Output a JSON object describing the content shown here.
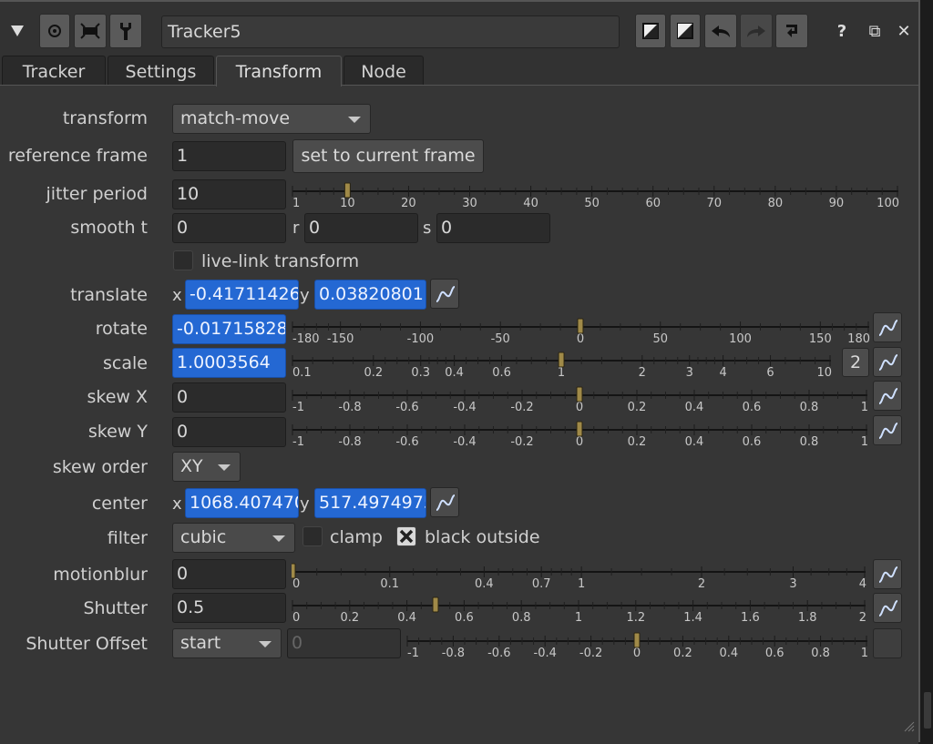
{
  "titlebar": {
    "node_name": "Tracker5",
    "help_glyph": "?",
    "float_glyph": "⧉",
    "close_glyph": "✕"
  },
  "tabs": [
    {
      "label": "Tracker"
    },
    {
      "label": "Settings"
    },
    {
      "label": "Transform"
    },
    {
      "label": "Node"
    }
  ],
  "transform": {
    "transform_label": "transform",
    "transform_value": "match-move",
    "reference_frame_label": "reference frame",
    "reference_frame_value": "1",
    "set_current_frame_label": "set to current frame",
    "jitter_label": "jitter period",
    "jitter_value": "10",
    "smooth_label": "smooth t",
    "smooth_t": "0",
    "smooth_r_label": "r",
    "smooth_r": "0",
    "smooth_s_label": "s",
    "smooth_s": "0",
    "live_link_label": "live-link transform",
    "translate_label": "translate",
    "translate_x_label": "x",
    "translate_x": "-0.417114261",
    "translate_y_label": "y",
    "translate_y": "0.03820801",
    "rotate_label": "rotate",
    "rotate_value": "-0.0171582842",
    "scale_label": "scale",
    "scale_value": "1.0003564",
    "scale_dim_button": "2",
    "skewx_label": "skew X",
    "skewx_value": "0",
    "skewy_label": "skew Y",
    "skewy_value": "0",
    "skew_order_label": "skew order",
    "skew_order_value": "XY",
    "center_label": "center",
    "center_x_label": "x",
    "center_x": "1068.407470",
    "center_y_label": "y",
    "center_y": "517.4974975",
    "filter_label": "filter",
    "filter_value": "cubic",
    "clamp_label": "clamp",
    "black_outside_label": "black outside",
    "black_outside_checked": true,
    "motionblur_label": "motionblur",
    "motionblur_value": "0",
    "shutter_label": "Shutter",
    "shutter_value": "0.5",
    "shutter_offset_label": "Shutter Offset",
    "shutter_offset_value": "start",
    "shutter_custom_value": "0"
  },
  "sliders": {
    "jitter": {
      "ticks": [
        "1",
        "10",
        "20",
        "30",
        "40",
        "50",
        "60",
        "70",
        "80",
        "90",
        "100"
      ],
      "value": 10
    },
    "rotate": {
      "ticks": [
        "-180",
        "-150",
        "-100",
        "-50",
        "0",
        "50",
        "100",
        "150",
        "180"
      ],
      "value": -0.0171582842
    },
    "scale": {
      "ticks": [
        "0.1",
        "0.2",
        "0.3",
        "0.4",
        "0.6",
        "1",
        "2",
        "3",
        "4",
        "6",
        "10"
      ],
      "value": 1.0003564
    },
    "skewx": {
      "ticks": [
        "-1",
        "-0.8",
        "-0.6",
        "-0.4",
        "-0.2",
        "0",
        "0.2",
        "0.4",
        "0.6",
        "0.8",
        "1"
      ],
      "value": 0
    },
    "skewy": {
      "ticks": [
        "-1",
        "-0.8",
        "-0.6",
        "-0.4",
        "-0.2",
        "0",
        "0.2",
        "0.4",
        "0.6",
        "0.8",
        "1"
      ],
      "value": 0
    },
    "motionblur": {
      "ticks": [
        "0",
        "0.1",
        "0.4",
        "0.7",
        "1",
        "2",
        "3",
        "4"
      ],
      "value": 0
    },
    "shutter": {
      "ticks": [
        "0",
        "0.2",
        "0.4",
        "0.6",
        "0.8",
        "1",
        "1.2",
        "1.4",
        "1.6",
        "1.8",
        "2"
      ],
      "value": 0.5
    },
    "shutter_offset": {
      "ticks": [
        "-1",
        "-0.8",
        "-0.6",
        "-0.4",
        "-0.2",
        "0",
        "0.2",
        "0.4",
        "0.6",
        "0.8",
        "1"
      ],
      "value": 0
    }
  }
}
